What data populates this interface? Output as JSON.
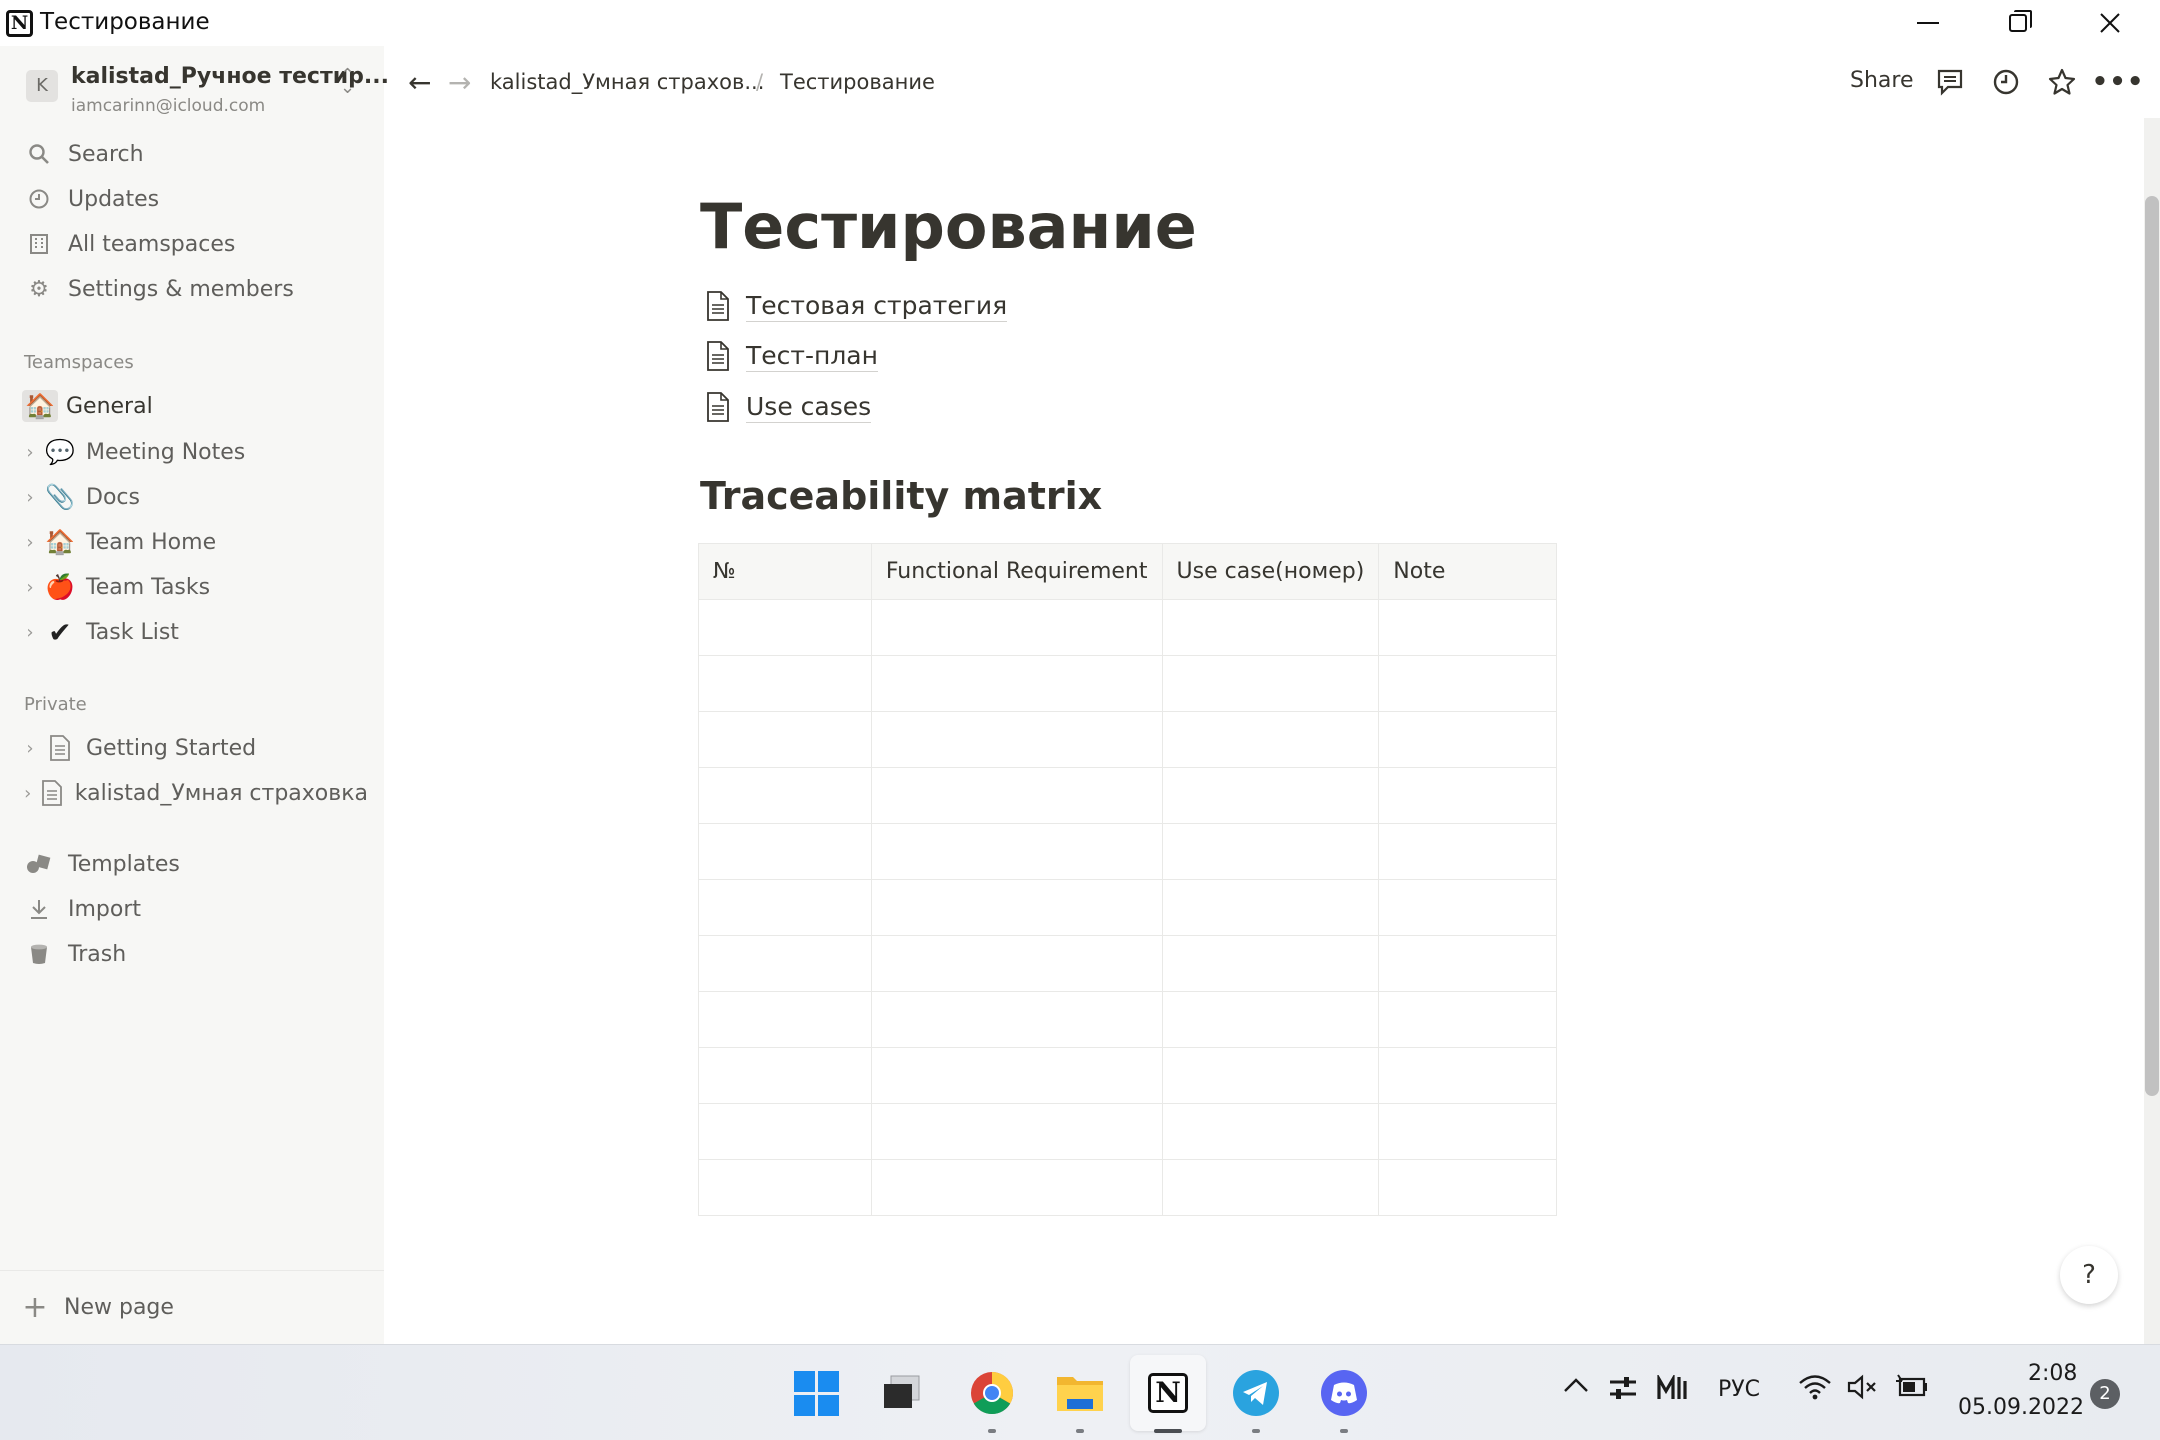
{
  "window": {
    "title": "Тестирование"
  },
  "workspace": {
    "avatar_letter": "K",
    "name": "kalistad_Ручное тестир...",
    "email": "iamcarinn@icloud.com"
  },
  "nav": [
    {
      "label": "Search",
      "icon": "search-icon"
    },
    {
      "label": "Updates",
      "icon": "clock-icon"
    },
    {
      "label": "All teamspaces",
      "icon": "building-icon"
    },
    {
      "label": "Settings & members",
      "icon": "gear-icon"
    }
  ],
  "teamspaces": {
    "section_label": "Teamspaces",
    "general": "General",
    "items": [
      {
        "label": "Meeting Notes",
        "emoji": "💬"
      },
      {
        "label": "Docs",
        "emoji": "📎"
      },
      {
        "label": "Team Home",
        "emoji": "🏠"
      },
      {
        "label": "Team Tasks",
        "emoji": "🍎"
      },
      {
        "label": "Task List",
        "emoji": "✔"
      }
    ]
  },
  "private": {
    "section_label": "Private",
    "items": [
      {
        "label": "Getting Started"
      },
      {
        "label": "kalistad_Умная страховка"
      }
    ]
  },
  "bottom_nav": [
    {
      "label": "Templates"
    },
    {
      "label": "Import"
    },
    {
      "label": "Trash"
    }
  ],
  "new_page": "New page",
  "topbar": {
    "back": "←",
    "forward": "→",
    "breadcrumb_parent": "kalistad_Умная страхов...",
    "breadcrumb_sep": "/",
    "breadcrumb_current": "Тестирование",
    "share": "Share",
    "more": "•••"
  },
  "page": {
    "title": "Тестирование",
    "subpages": [
      "Тестовая стратегия",
      "Тест-план",
      "Use cases"
    ],
    "heading": "Traceability matrix",
    "table": {
      "headers": [
        "№",
        "Functional Requirement",
        "Use case(номер)",
        "Note"
      ],
      "empty_rows": 11
    }
  },
  "help": "?",
  "taskbar": {
    "language": "РУС",
    "time": "2:08",
    "date": "05.09.2022",
    "notifications": "2"
  }
}
